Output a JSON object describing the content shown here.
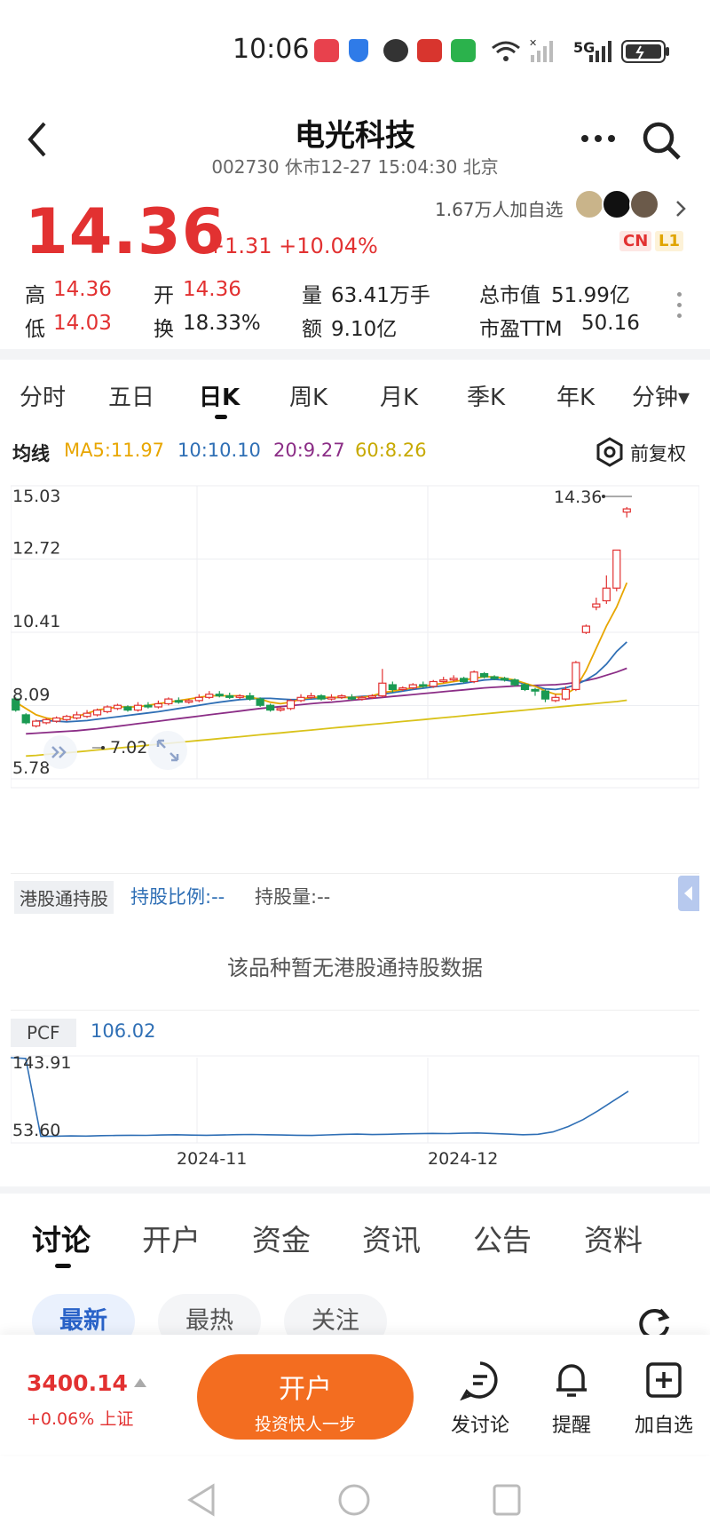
{
  "status_bar": {
    "time": "10:06",
    "network": "5G"
  },
  "nav": {
    "title": "电光科技",
    "subtitle": "002730 休市12-27 15:04:30 北京"
  },
  "quote": {
    "price": "14.36",
    "change": "+1.31 +10.04%",
    "followers": "1.67万人加自选",
    "tag_cn": "CN",
    "tag_l1": "L1",
    "stats": {
      "high_label": "高",
      "high": "14.36",
      "open_label": "开",
      "open": "14.36",
      "volume_label": "量",
      "volume": "63.41万手",
      "mktcap_label": "总市值",
      "mktcap": "51.99亿",
      "low_label": "低",
      "low": "14.03",
      "turnover_label": "换",
      "turnover": "18.33%",
      "amount_label": "额",
      "amount": "9.10亿",
      "pe_label": "市盈TTM",
      "pe": "50.16"
    }
  },
  "periods": [
    "分时",
    "五日",
    "日K",
    "周K",
    "月K",
    "季K",
    "年K",
    "分钟▾"
  ],
  "ma_bar": {
    "label": "均线",
    "ma5": "MA5:11.97",
    "ma10": "10:10.10",
    "ma20": "20:9.27",
    "ma60": "60:8.26",
    "adjust": "前复权",
    "colors": {
      "ma5": "#e8a600",
      "ma10": "#2f6fb5",
      "ma20": "#8b2d86",
      "ma60": "#d9c21a",
      "up": "#e23131",
      "down": "#1a9a52"
    }
  },
  "chart_data": {
    "type": "candlestick",
    "y_ticks": [
      "15.03",
      "12.72",
      "10.41",
      "8.09",
      "5.78"
    ],
    "ylim": [
      5.78,
      15.03
    ],
    "high_marker": "14.36",
    "low_marker": "7.02",
    "candles": [
      [
        8.3,
        7.95,
        8.35,
        7.9
      ],
      [
        7.8,
        7.55,
        7.85,
        7.5
      ],
      [
        7.45,
        7.6,
        7.65,
        7.4
      ],
      [
        7.55,
        7.65,
        7.7,
        7.5
      ],
      [
        7.6,
        7.7,
        7.75,
        7.55
      ],
      [
        7.65,
        7.75,
        7.8,
        7.6
      ],
      [
        7.7,
        7.8,
        7.9,
        7.65
      ],
      [
        7.75,
        7.85,
        7.95,
        7.7
      ],
      [
        7.8,
        7.95,
        8.0,
        7.75
      ],
      [
        7.9,
        8.05,
        8.1,
        7.85
      ],
      [
        8.0,
        8.1,
        8.15,
        7.95
      ],
      [
        8.05,
        7.95,
        8.1,
        7.9
      ],
      [
        7.95,
        8.1,
        8.2,
        7.9
      ],
      [
        8.1,
        8.05,
        8.2,
        8.0
      ],
      [
        8.05,
        8.15,
        8.25,
        8.0
      ],
      [
        8.15,
        8.3,
        8.35,
        8.1
      ],
      [
        8.25,
        8.2,
        8.35,
        8.15
      ],
      [
        8.2,
        8.25,
        8.3,
        8.15
      ],
      [
        8.25,
        8.35,
        8.45,
        8.2
      ],
      [
        8.35,
        8.45,
        8.55,
        8.3
      ],
      [
        8.45,
        8.4,
        8.55,
        8.35
      ],
      [
        8.4,
        8.35,
        8.5,
        8.3
      ],
      [
        8.35,
        8.4,
        8.45,
        8.3
      ],
      [
        8.4,
        8.3,
        8.5,
        8.25
      ],
      [
        8.3,
        8.1,
        8.35,
        8.05
      ],
      [
        8.1,
        7.95,
        8.15,
        7.9
      ],
      [
        7.95,
        8.0,
        8.05,
        7.9
      ],
      [
        8.0,
        8.25,
        8.3,
        7.95
      ],
      [
        8.25,
        8.35,
        8.45,
        8.2
      ],
      [
        8.35,
        8.4,
        8.5,
        8.3
      ],
      [
        8.4,
        8.3,
        8.45,
        8.25
      ],
      [
        8.3,
        8.35,
        8.45,
        8.25
      ],
      [
        8.35,
        8.4,
        8.45,
        8.3
      ],
      [
        8.35,
        8.3,
        8.45,
        8.25
      ],
      [
        8.3,
        8.35,
        8.4,
        8.25
      ],
      [
        8.35,
        8.4,
        8.45,
        8.3
      ],
      [
        8.4,
        8.8,
        9.25,
        8.35
      ],
      [
        8.75,
        8.6,
        8.85,
        8.5
      ],
      [
        8.6,
        8.65,
        8.7,
        8.55
      ],
      [
        8.65,
        8.75,
        8.8,
        8.6
      ],
      [
        8.75,
        8.7,
        8.85,
        8.65
      ],
      [
        8.7,
        8.85,
        8.9,
        8.65
      ],
      [
        8.85,
        8.9,
        9.0,
        8.8
      ],
      [
        8.9,
        8.95,
        9.05,
        8.85
      ],
      [
        8.95,
        8.85,
        9.0,
        8.8
      ],
      [
        8.85,
        9.15,
        9.2,
        8.8
      ],
      [
        9.1,
        9.0,
        9.15,
        8.95
      ],
      [
        9.0,
        8.95,
        9.05,
        8.9
      ],
      [
        8.95,
        8.9,
        9.0,
        8.85
      ],
      [
        8.9,
        8.75,
        8.95,
        8.7
      ],
      [
        8.75,
        8.6,
        8.8,
        8.55
      ],
      [
        8.6,
        8.55,
        8.65,
        8.4
      ],
      [
        8.55,
        8.3,
        8.6,
        8.2
      ],
      [
        8.25,
        8.35,
        8.45,
        8.2
      ],
      [
        8.3,
        8.6,
        8.7,
        8.25
      ],
      [
        8.6,
        9.45,
        9.5,
        8.55
      ],
      [
        10.4,
        10.6,
        10.65,
        10.35
      ],
      [
        11.2,
        11.3,
        11.5,
        11.1
      ],
      [
        11.4,
        11.8,
        12.2,
        11.3
      ],
      [
        11.8,
        13.0,
        13.0,
        11.7
      ],
      [
        14.2,
        14.3,
        14.36,
        14.03
      ]
    ],
    "ma5": [
      8.2,
      8.0,
      7.8,
      7.7,
      7.65,
      7.7,
      7.75,
      7.85,
      7.95,
      8.0,
      8.05,
      8.05,
      8.05,
      8.1,
      8.15,
      8.2,
      8.25,
      8.3,
      8.35,
      8.4,
      8.4,
      8.4,
      8.4,
      8.35,
      8.3,
      8.2,
      8.15,
      8.2,
      8.3,
      8.35,
      8.35,
      8.35,
      8.35,
      8.35,
      8.35,
      8.4,
      8.5,
      8.55,
      8.6,
      8.65,
      8.7,
      8.75,
      8.8,
      8.85,
      8.9,
      8.95,
      9.0,
      9.0,
      8.95,
      8.9,
      8.8,
      8.7,
      8.55,
      8.45,
      8.45,
      8.65,
      9.2,
      9.9,
      10.6,
      11.2,
      11.97
    ],
    "ma10": [
      7.6,
      7.62,
      7.6,
      7.58,
      7.6,
      7.62,
      7.66,
      7.7,
      7.74,
      7.78,
      7.82,
      7.86,
      7.9,
      7.95,
      8.0,
      8.05,
      8.1,
      8.15,
      8.2,
      8.24,
      8.28,
      8.3,
      8.32,
      8.32,
      8.3,
      8.28,
      8.28,
      8.3,
      8.32,
      8.34,
      8.35,
      8.36,
      8.38,
      8.4,
      8.45,
      8.5,
      8.55,
      8.6,
      8.64,
      8.68,
      8.72,
      8.76,
      8.8,
      8.85,
      8.9,
      8.92,
      8.9,
      8.85,
      8.78,
      8.7,
      8.62,
      8.6,
      8.65,
      8.75,
      8.9,
      9.1,
      9.4,
      9.8,
      10.1
    ],
    "ma20": [
      7.2,
      7.22,
      7.24,
      7.26,
      7.28,
      7.3,
      7.33,
      7.36,
      7.4,
      7.44,
      7.48,
      7.52,
      7.56,
      7.6,
      7.64,
      7.68,
      7.72,
      7.76,
      7.8,
      7.84,
      7.88,
      7.92,
      7.96,
      8.0,
      8.03,
      8.06,
      8.09,
      8.12,
      8.15,
      8.18,
      8.2,
      8.23,
      8.26,
      8.29,
      8.32,
      8.35,
      8.38,
      8.41,
      8.44,
      8.47,
      8.5,
      8.53,
      8.56,
      8.59,
      8.62,
      8.65,
      8.67,
      8.69,
      8.71,
      8.72,
      8.73,
      8.74,
      8.75,
      8.78,
      8.82,
      8.88,
      8.95,
      9.05,
      9.15,
      9.27
    ],
    "ma60": [
      6.5,
      6.52,
      6.55,
      6.58,
      6.6,
      6.63,
      6.66,
      6.69,
      6.72,
      6.75,
      6.78,
      6.81,
      6.84,
      6.87,
      6.9,
      6.93,
      6.96,
      6.99,
      7.02,
      7.05,
      7.08,
      7.11,
      7.14,
      7.17,
      7.2,
      7.23,
      7.26,
      7.29,
      7.32,
      7.35,
      7.38,
      7.41,
      7.44,
      7.47,
      7.5,
      7.53,
      7.56,
      7.59,
      7.62,
      7.65,
      7.68,
      7.71,
      7.74,
      7.77,
      7.8,
      7.83,
      7.86,
      7.89,
      7.92,
      7.95,
      7.98,
      8.01,
      8.04,
      8.07,
      8.1,
      8.13,
      8.16,
      8.19,
      8.22,
      8.26
    ]
  },
  "hk_holdings": {
    "label": "港股通持股",
    "ratio": "持股比例:--",
    "amount": "持股量:--",
    "empty": "该品种暂无港股通持股数据"
  },
  "pcf": {
    "label": "PCF",
    "value": "106.02",
    "y_ticks": [
      "143.91",
      "53.60"
    ],
    "x_ticks": [
      "2024-11",
      "2024-12"
    ],
    "ylim": [
      53.6,
      143.91
    ],
    "values": [
      143.9,
      143.0,
      55,
      55.2,
      55.5,
      55.3,
      55.8,
      56.0,
      56.2,
      56.1,
      56.5,
      56.8,
      56.4,
      56.2,
      56.5,
      56.9,
      57.1,
      56.8,
      56.5,
      56.2,
      56.0,
      56.6,
      57.2,
      57.5,
      57.0,
      57.3,
      57.8,
      58.0,
      58.3,
      58.1,
      58.5,
      58.8,
      58.2,
      57.5,
      56.8,
      57.3,
      60,
      66,
      74,
      84,
      95,
      106.02
    ]
  },
  "tabs": [
    "讨论",
    "开户",
    "资金",
    "资讯",
    "公告",
    "资料"
  ],
  "chips": [
    "最新",
    "最热",
    "关注"
  ],
  "bottom_bar": {
    "index_value": "3400.14",
    "index_change": "+0.06% 上证",
    "open_account": "开户",
    "open_account_sub": "投资快人一步",
    "post": "发讨论",
    "alert": "提醒",
    "watch": "加自选"
  }
}
